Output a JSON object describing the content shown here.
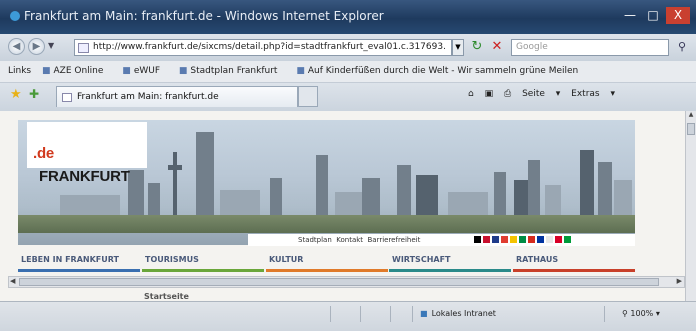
{
  "window": {
    "title": "Frankfurt am Main: frankfurt.de - Windows Internet Explorer",
    "minimize_icon": "minimize-icon",
    "maximize_icon": "maximize-icon",
    "close_label": "X"
  },
  "nav": {
    "back_icon": "back-arrow-icon",
    "forward_icon": "forward-arrow-icon",
    "address": "http://www.frankfurt.de/sixcms/detail.php?id=stadtfrankfurt_eval01.c.317693.",
    "search_placeholder": "Google",
    "refresh_icon": "refresh-icon",
    "stop_icon": "stop-icon",
    "search_icon": "search-icon"
  },
  "favorites_bar": {
    "label": "Links",
    "items": [
      {
        "label": "AZE Online",
        "icon": "favorite-link-icon"
      },
      {
        "label": "eWUF",
        "icon": "favorite-link-icon"
      },
      {
        "label": "Stadtplan Frankfurt",
        "icon": "favorite-link-icon"
      },
      {
        "label": "Auf Kinderfüßen durch die Welt - Wir sammeln grüne Meilen",
        "icon": "favorite-link-icon"
      }
    ]
  },
  "tabs": {
    "active_title": "Frankfurt am Main: frankfurt.de"
  },
  "command_bar": {
    "home_icon": "home-icon",
    "feeds_icon": "feeds-icon",
    "print_icon": "print-icon",
    "page_label": "Seite",
    "tools_label": "Extras"
  },
  "site": {
    "logo_main": "FRANKFURT",
    "logo_suffix": ".de",
    "util_links": [
      "Stadtplan",
      "Kontakt",
      "Barrierefreiheit"
    ],
    "flag_colors": [
      "#000000",
      "#c8102e",
      "#1f3b8a",
      "#e03c31",
      "#f4c300",
      "#008c45",
      "#d52b1e",
      "#0033a0",
      "#e8e8e8",
      "#d80027",
      "#009b3a"
    ],
    "nav": [
      {
        "label": "LEBEN IN FRANKFURT",
        "color": "#3a6fb0"
      },
      {
        "label": "TOURISMUS",
        "color": "#6aa63a"
      },
      {
        "label": "KULTUR",
        "color": "#e07a2a"
      },
      {
        "label": "WIRTSCHAFT",
        "color": "#2a8a8a"
      },
      {
        "label": "RATHAUS",
        "color": "#c8402a"
      }
    ],
    "breadcrumb": "Startseite"
  },
  "statusbar": {
    "zone": "Lokales Intranet",
    "zoom": "100%"
  }
}
